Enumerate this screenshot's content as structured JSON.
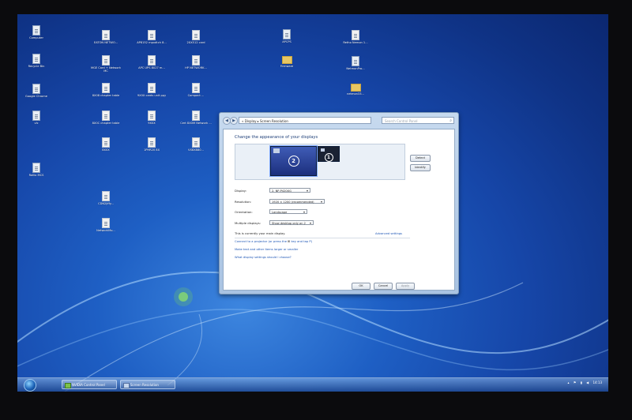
{
  "desktop_icons": [
    {
      "label": "Computer",
      "kind": "app"
    },
    {
      "label": "Recycle Bin",
      "kind": "app"
    },
    {
      "label": "Google Chrome",
      "kind": "app"
    },
    {
      "label": "vlc",
      "kind": "app"
    },
    {
      "label": "Rallio MCS",
      "kind": "app"
    },
    {
      "label": "EATON NETWO...",
      "kind": "file"
    },
    {
      "label": "MGE Card + Network MC",
      "kind": "file"
    },
    {
      "label": "8X08 chapter table",
      "kind": "file"
    },
    {
      "label": "8X0C chapter table",
      "kind": "file"
    },
    {
      "label": "8X0X",
      "kind": "file"
    },
    {
      "label": "CDN2Jiffy...",
      "kind": "file"
    },
    {
      "label": "NetworkMo...",
      "kind": "file"
    },
    {
      "label": "AP8152 mpxdtch 8...",
      "kind": "file"
    },
    {
      "label": "APC UPS 8027 m...",
      "kind": "file"
    },
    {
      "label": "9X0X cards unit ppy",
      "kind": "file"
    },
    {
      "label": "9X0X",
      "kind": "file"
    },
    {
      "label": "1PHR20 8X",
      "kind": "file"
    },
    {
      "label": "2XX512 card",
      "kind": "file"
    },
    {
      "label": "HP NETWORK...",
      "kind": "file"
    },
    {
      "label": "Compact ...",
      "kind": "file"
    },
    {
      "label": "Cert 8X0M Network ...",
      "kind": "file"
    },
    {
      "label": "VX8X880...",
      "kind": "file"
    },
    {
      "label": "APCPS",
      "kind": "app"
    },
    {
      "label": "Firmware",
      "kind": "folder"
    },
    {
      "label": "Retho Nemon 1...",
      "kind": "file"
    },
    {
      "label": "NetmonPro...",
      "kind": "app"
    },
    {
      "label": "netmon33...",
      "kind": "folder"
    }
  ],
  "window": {
    "address": "« Display ▸ Screen Resolution",
    "search_placeholder": "Search Control Panel",
    "heading": "Change the appearance of your displays",
    "monitors": [
      {
        "num": "2",
        "selected": true
      },
      {
        "num": "1",
        "selected": false
      }
    ],
    "detect": "Detect",
    "identify": "Identify",
    "display_label": "Display:",
    "display_value": "2. NP-P420XG",
    "resolution_label": "Resolution:",
    "resolution_value": "1920 × 1200 (recommended)",
    "orientation_label": "Orientation:",
    "orientation_value": "Landscape",
    "multiple_label": "Multiple displays:",
    "multiple_value": "Show desktop only on 2",
    "main_display_note": "This is currently your main display.",
    "advanced_link": "Advanced settings",
    "projector_link": "Connect to a projector (or press the",
    "projector_suffix": "key and tap P)",
    "text_size_link": "Make text and other items larger or smaller",
    "which_settings_link": "What display settings should I choose?",
    "ok": "OK",
    "cancel": "Cancel",
    "apply": "Apply"
  },
  "taskbar": {
    "items": [
      "NVIDIA Control Panel",
      "Screen Resolution"
    ],
    "clock": "14:13"
  }
}
